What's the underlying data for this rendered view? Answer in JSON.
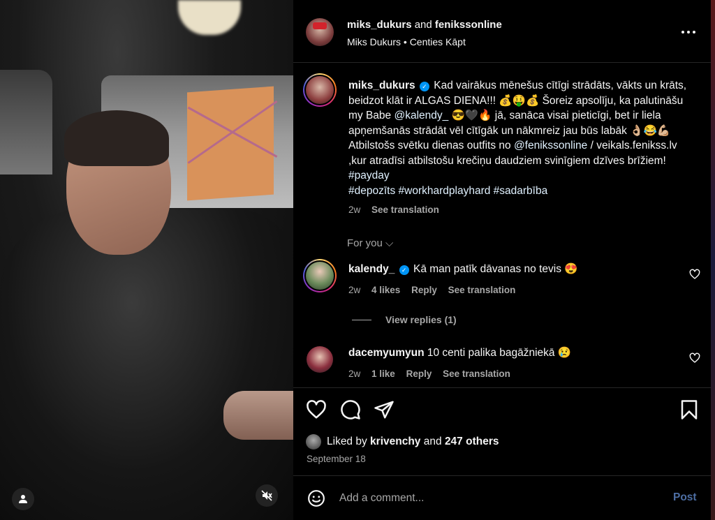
{
  "header": {
    "user1": "miks_dukurs",
    "and": "and",
    "user2": "fenikssonline",
    "subtitle": "Miks Dukurs • Centies Kāpt",
    "more_icon": "more-horizontal-icon"
  },
  "caption": {
    "username": "miks_dukurs",
    "text_part1": "Kad vairākus mēnešus cītīgi strādāts, vākts un krāts, beidzot klāt ir ALGAS DIENA!!! 💰🤑💰 Šoreiz apsolīju, ka palutināšu my Babe ",
    "mention1": "@kalendy_",
    "text_part2": " 😎🖤🔥 jā, sanāca visai pieticīgi, bet ir liela apņemšanās strādāt vēl cītīgāk un nākmreiz jau būs labāk 👌🏼😂💪🏼 Atbilstošs svētku dienas outfits no ",
    "mention2": "@fenikssonline",
    "text_part3": " / veikals.fenikss.lv ,kur atradīsi atbilstošu krečiņu daudziem svinīgiem dzīves brīžiem! ",
    "hashtags1": "#payday",
    "hashtags2": "#depozīts #workhardplayhard #sadarbība",
    "age": "2w",
    "see_translation": "See translation"
  },
  "for_you": "For you ⌵",
  "comments": [
    {
      "username": "kalendy_",
      "text": "Kā man patīk dāvanas no tevis 😍",
      "age": "2w",
      "likes": "4 likes",
      "reply": "Reply",
      "see_translation": "See translation",
      "view_replies": "View replies (1)"
    },
    {
      "username": "dacemyumyun",
      "text": "10 centi palika bagāžniekā 😢",
      "age": "2w",
      "likes": "1 like",
      "reply": "Reply",
      "see_translation": "See translation"
    }
  ],
  "likes": {
    "prefix": "Liked by",
    "user": "krivenchy",
    "suffix": "and",
    "count": "247 others"
  },
  "date": "September 18",
  "add_comment": {
    "placeholder": "Add a comment...",
    "post": "Post"
  },
  "colors": {
    "background": "#000000",
    "text": "#f5f5f5",
    "secondary": "#a8a8a8",
    "link": "#e0f1ff",
    "verified": "#0095f6",
    "post_disabled": "#4d6ea3"
  }
}
